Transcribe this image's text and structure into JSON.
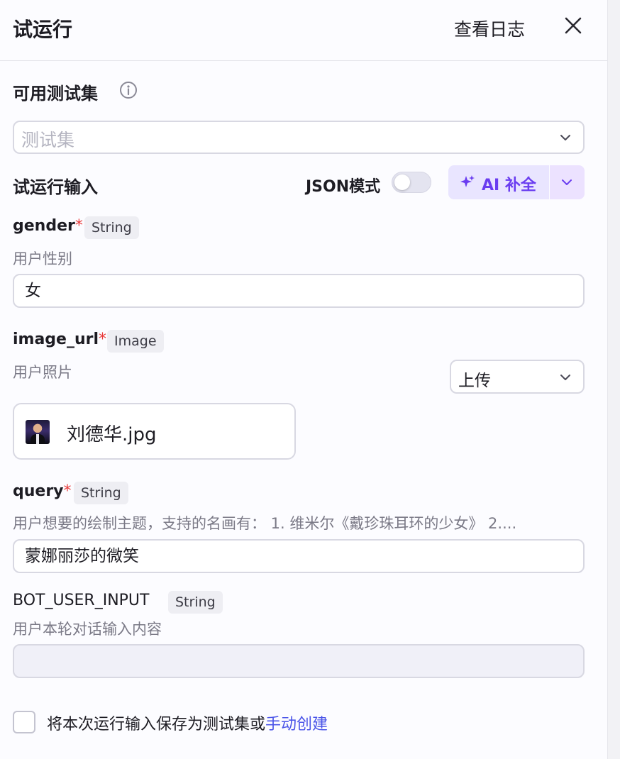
{
  "header": {
    "title": "试运行",
    "view_log": "查看日志"
  },
  "test_set": {
    "section_title": "可用测试集",
    "placeholder": "测试集"
  },
  "run_input": {
    "section_title": "试运行输入",
    "json_mode_label": "JSON模式",
    "json_mode_on": false,
    "ai_button_label": "AI 补全"
  },
  "fields": [
    {
      "name": "gender",
      "required": "*",
      "type": "String",
      "description": "用户性别",
      "value": "女"
    },
    {
      "name": "image_url",
      "required": "*",
      "type": "Image",
      "description": "用户照片",
      "upload_mode": "上传",
      "file_name": "刘德华.jpg"
    },
    {
      "name": "query",
      "required": "*",
      "type": "String",
      "description": "用户想要的绘制主题，支持的名画有： 1. 维米尔《戴珍珠耳环的少女》 2....",
      "value": "蒙娜丽莎的微笑"
    },
    {
      "name": "BOT_USER_INPUT",
      "type": "String",
      "description": "用户本轮对话输入内容",
      "value": ""
    }
  ],
  "footer": {
    "save_text": "将本次运行输入保存为测试集或",
    "create_link": "手动创建"
  },
  "colors": {
    "accent": "#6a3df0",
    "link": "#4b55e8",
    "required": "#e83a3a"
  }
}
